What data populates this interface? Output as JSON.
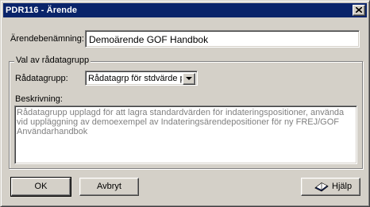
{
  "window": {
    "title": "PDR116 - Ärende",
    "close_symbol": "×"
  },
  "form": {
    "name_label": "Ärendebenämning:",
    "name_value": "Demoärende GOF Handbok"
  },
  "group": {
    "title": "Val av rådatagrupp",
    "radatagrupp_label": "Rådatagrupp:",
    "radatagrupp_selected": "Rådatagrp för stdvärde p",
    "description_label": "Beskrivning:",
    "description_text": "Rådatagrupp upplagd för att lagra standardvärden för indateringspositioner, använda vid uppläggning av demoexempel av Indateringsärendepositioner för ny FREJ/GOF Användarhandbok"
  },
  "buttons": {
    "ok": "OK",
    "cancel": "Avbryt",
    "help": "Hjälp"
  },
  "icons": {
    "close": "close-icon",
    "dropdown": "chevron-down-icon",
    "help": "help-book-icon"
  },
  "colors": {
    "titlebar": "#0a246a",
    "face": "#d4d0c8",
    "disabled_text": "#808080"
  }
}
